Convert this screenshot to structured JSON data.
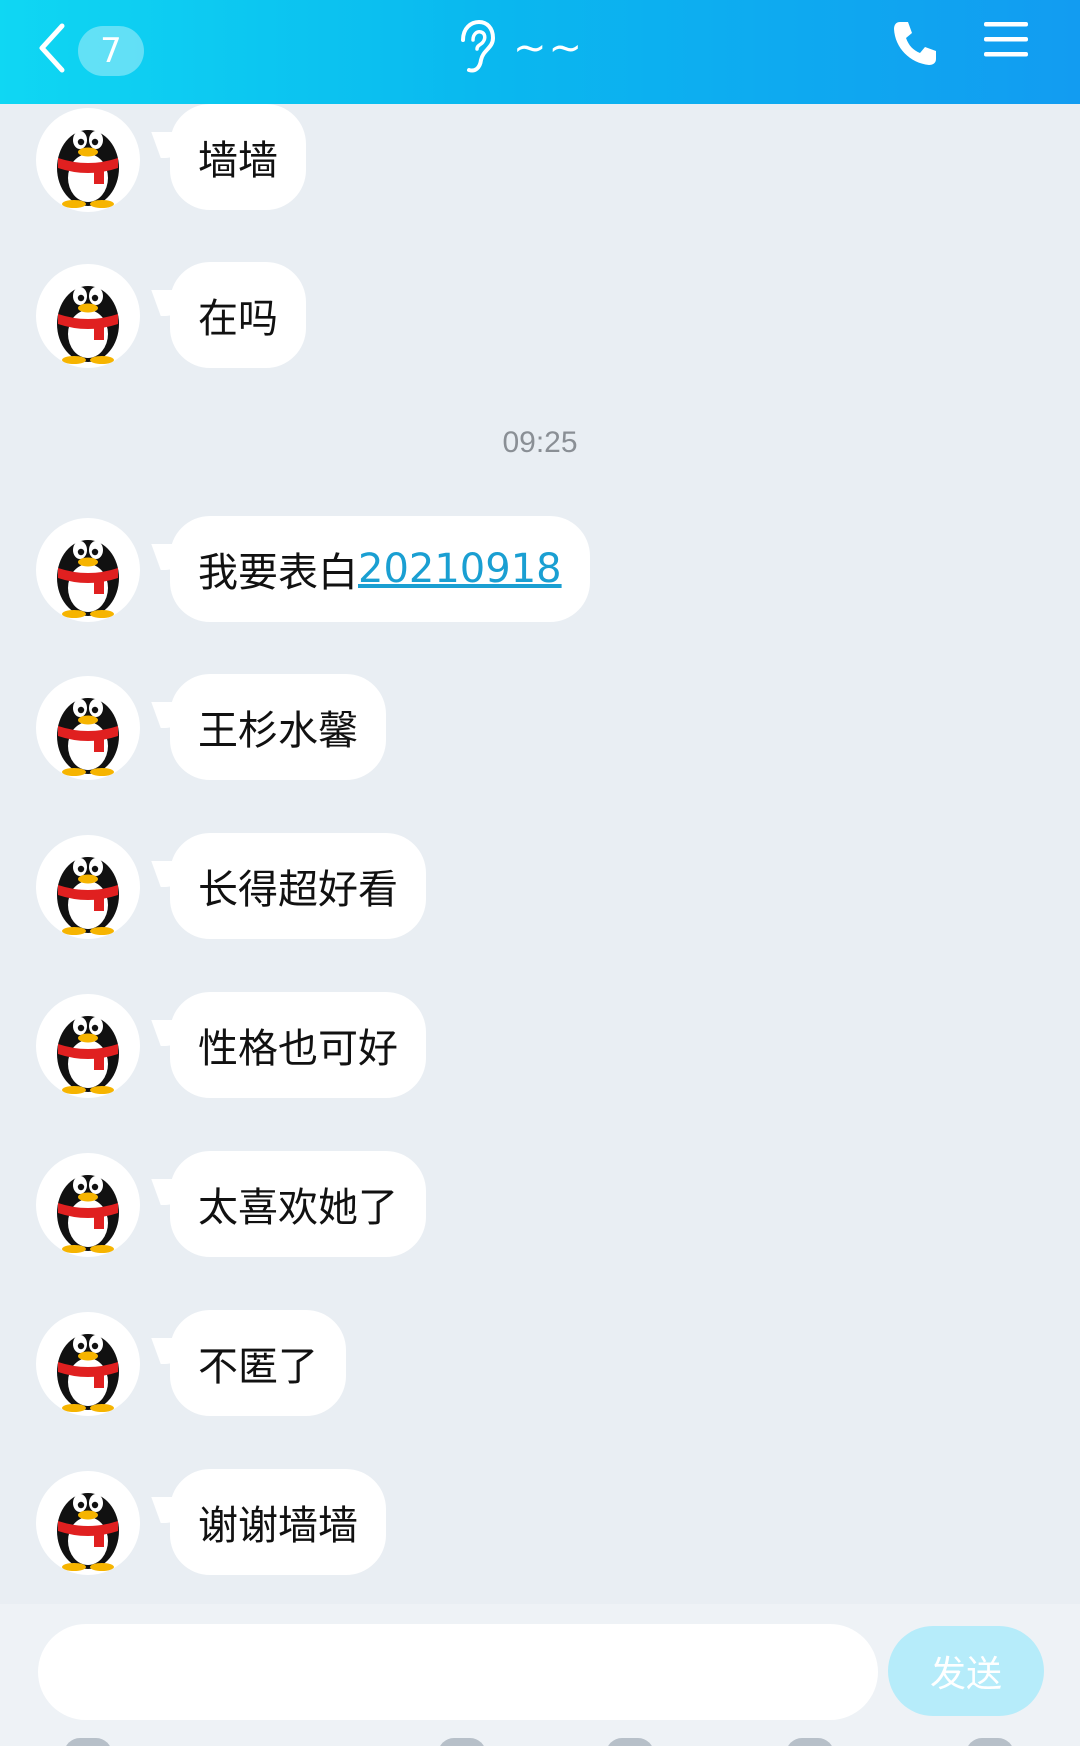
{
  "header": {
    "unread_count": "7",
    "title": "~~"
  },
  "messages": [
    {
      "text": "墙墙"
    },
    {
      "text": "在吗"
    },
    {
      "timestamp": "09:25"
    },
    {
      "text": "我要表白",
      "link": "20210918"
    },
    {
      "text": "王杉水馨"
    },
    {
      "text": "长得超好看"
    },
    {
      "text": "性格也可好"
    },
    {
      "text": "太喜欢她了"
    },
    {
      "text": "不匿了"
    },
    {
      "text": "谢谢墙墙"
    }
  ],
  "input": {
    "value": "",
    "placeholder": "",
    "send_label": "发送"
  },
  "icons": {
    "back": "chevron-left-icon",
    "voice_mode": "ear-icon",
    "call": "phone-icon",
    "menu": "hamburger-menu-icon",
    "avatar": "penguin-avatar"
  },
  "colors": {
    "header_gradient_start": "#0fd7f3",
    "header_gradient_end": "#129cf1",
    "background": "#e9eef3",
    "bubble": "#ffffff",
    "link": "#1a9fd2",
    "send_button": "#b6ecfa"
  }
}
